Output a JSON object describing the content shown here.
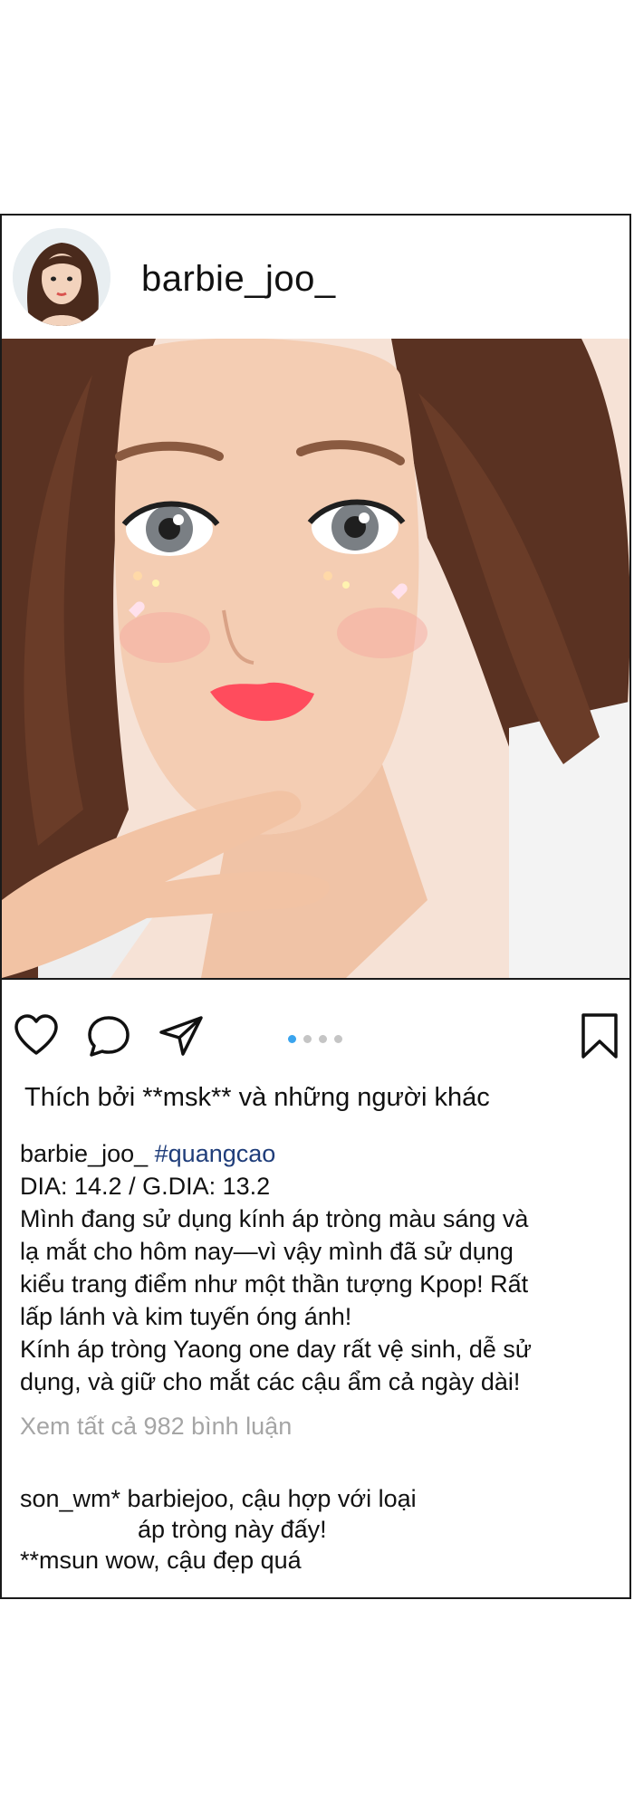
{
  "post": {
    "username": "barbie_joo_",
    "likes_text": "Thích bởi **msk** và những người khác",
    "caption": {
      "user": "barbie_joo_",
      "hashtag": "#quangcao",
      "specs": "DIA: 14.2 / G.DIA: 13.2",
      "lines": [
        "Mình đang sử dụng kính áp tròng màu sáng và",
        "lạ mắt cho hôm nay—vì vậy mình đã sử dụng",
        "kiểu trang điểm như một thần tượng Kpop! Rất",
        "lấp lánh và kim tuyến óng ánh!",
        "Kính áp tròng Yaong one day rất vệ sinh, dễ sử",
        "dụng, và giữ cho mắt các cậu ẩm cả ngày dài!"
      ]
    },
    "view_comments": "Xem tất cả 982 bình luận",
    "comments": [
      {
        "line1": "son_wm* barbiejoo, cậu hợp với loại",
        "line2": "áp tròng này đấy!"
      },
      {
        "line1": "**msun wow, cậu đẹp quá",
        "line2": ""
      }
    ],
    "carousel_total": 4,
    "carousel_active": 1
  },
  "colors": {
    "border": "#1a1a1a",
    "active_dot": "#3aa4ee",
    "inactive_dot": "#c5c5c5",
    "hashtag": "#1f3d7a",
    "muted_text": "#a5a5a5"
  },
  "icons": [
    "heart-icon",
    "comment-icon",
    "send-icon",
    "bookmark-icon"
  ]
}
